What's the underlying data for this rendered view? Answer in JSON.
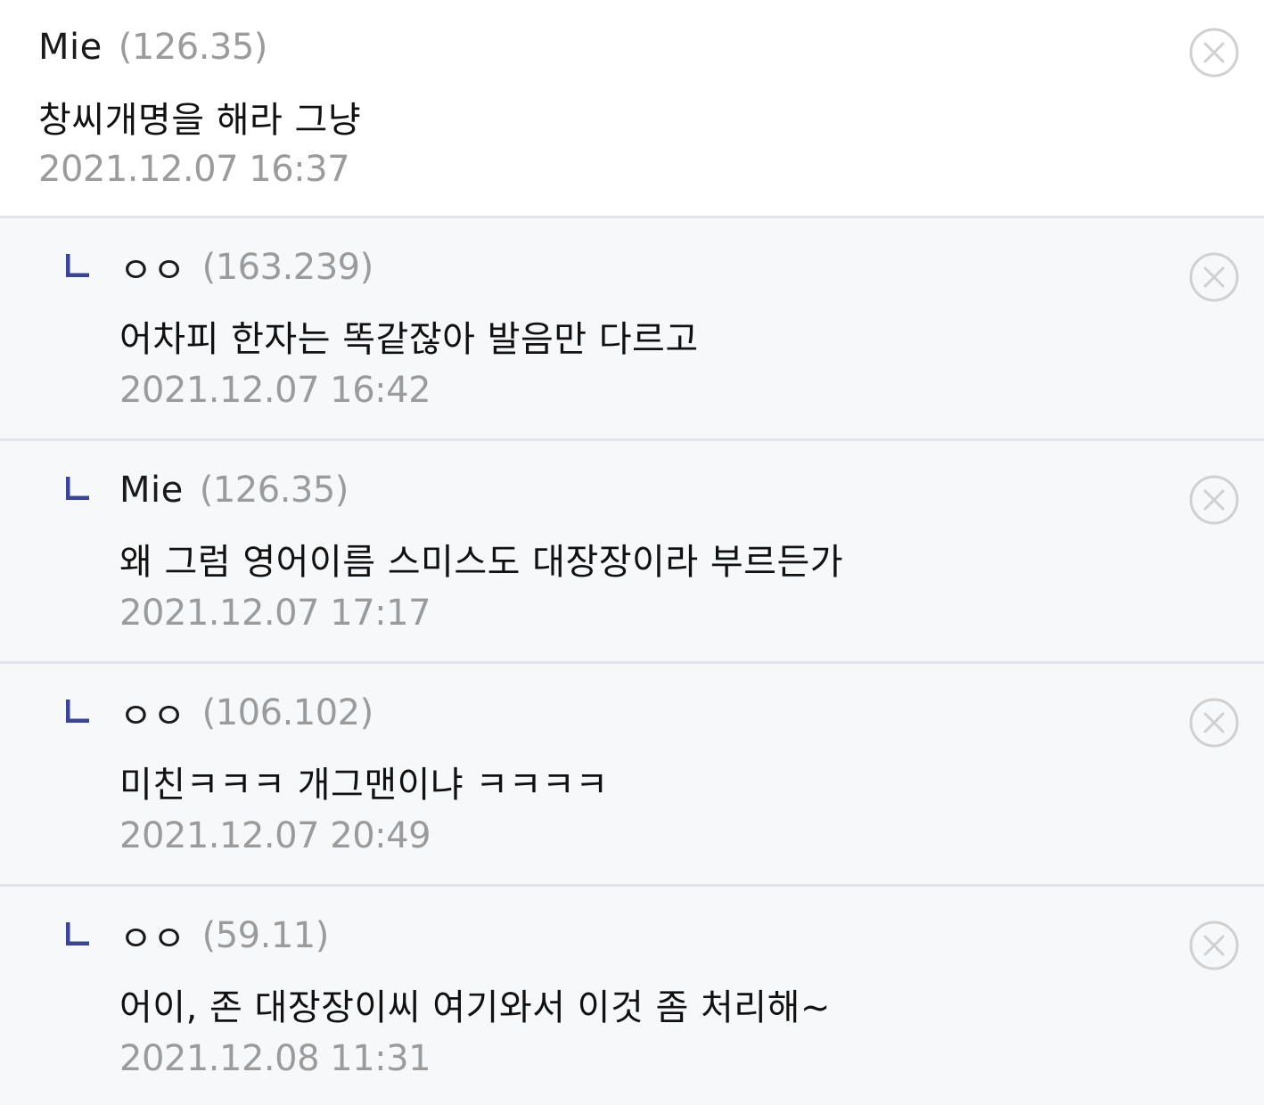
{
  "comments": [
    {
      "author": "Mie",
      "ip": "(126.35)",
      "text": "창씨개명을 해라 그냥",
      "date": "2021.12.07 16:37",
      "is_reply": false
    },
    {
      "author": "ㅇㅇ",
      "ip": "(163.239)",
      "text": "어차피 한자는 똑같잖아 발음만 다르고",
      "date": "2021.12.07 16:42",
      "is_reply": true
    },
    {
      "author": "Mie",
      "ip": "(126.35)",
      "text": "왜 그럼 영어이름 스미스도 대장장이라 부르든가",
      "date": "2021.12.07 17:17",
      "is_reply": true
    },
    {
      "author": "ㅇㅇ",
      "ip": "(106.102)",
      "text": "미친ㅋㅋㅋ 개그맨이냐 ㅋㅋㅋㅋ",
      "date": "2021.12.07 20:49",
      "is_reply": true
    },
    {
      "author": "ㅇㅇ",
      "ip": "(59.11)",
      "text": "어이, 존 대장장이씨 여기와서 이것 좀 처리해~",
      "date": "2021.12.08 11:31",
      "is_reply": true
    }
  ],
  "icons": {
    "reply": "reply-arrow-icon",
    "delete": "delete-circle-x-icon"
  },
  "colors": {
    "reply_marker": "#3a4494",
    "reply_background": "#f7f8fa",
    "divider": "#e1e4ec",
    "muted_text": "#9b9b9b",
    "close_icon": "#d0d0d0"
  }
}
